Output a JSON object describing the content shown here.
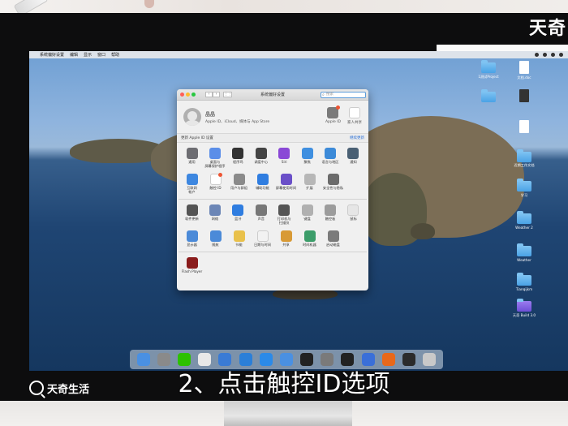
{
  "watermark_top": "天奇",
  "menubar": {
    "apple": "",
    "items": [
      "系统偏好设置",
      "编辑",
      "显示",
      "窗口",
      "帮助"
    ]
  },
  "window": {
    "title": "系统偏好设置",
    "search_placeholder": "搜索",
    "account": {
      "name": "晶晶",
      "subtitle": "Apple ID、iCloud、媒体与 App Store"
    },
    "top_buttons": [
      {
        "label": "Apple ID",
        "icon": "apple-id-icon"
      },
      {
        "label": "家人共享",
        "icon": "family-sharing-icon"
      }
    ],
    "notice": {
      "text": "更新 Apple ID 设置",
      "link": "继续更新"
    },
    "rows": [
      [
        {
          "label": "通用",
          "icon": "general-icon",
          "color": "#6d6d72"
        },
        {
          "label": "桌面与\n屏幕保护程序",
          "icon": "desktop-icon",
          "color": "#5b8ee8"
        },
        {
          "label": "程序坞",
          "icon": "dock-icon",
          "color": "#333333"
        },
        {
          "label": "调度中心",
          "icon": "mission-control-icon",
          "color": "#444444"
        },
        {
          "label": "Siri",
          "icon": "siri-icon",
          "color": "#8a48d6"
        },
        {
          "label": "聚焦",
          "icon": "spotlight-icon",
          "color": "#3f8fe0"
        },
        {
          "label": "语言与地区",
          "icon": "language-icon",
          "color": "#3c8ad8"
        },
        {
          "label": "通知",
          "icon": "notifications-icon",
          "color": "#4a6074"
        }
      ],
      [
        {
          "label": "互联网\n帐户",
          "icon": "internet-accounts-icon",
          "color": "#3d87e0"
        },
        {
          "label": "触控 ID",
          "icon": "touch-id-icon",
          "color": "#ffffff"
        },
        {
          "label": "用户与群组",
          "icon": "users-icon",
          "color": "#8a8a8a"
        },
        {
          "label": "辅助功能",
          "icon": "accessibility-icon",
          "color": "#2f7de0"
        },
        {
          "label": "屏幕使用时间",
          "icon": "screen-time-icon",
          "color": "#6a4fc8"
        },
        {
          "label": "扩展",
          "icon": "extensions-icon",
          "color": "#b7b7b7"
        },
        {
          "label": "安全性与隐私",
          "icon": "security-icon",
          "color": "#6b6b6b"
        }
      ],
      [
        {
          "label": "软件更新",
          "icon": "software-update-icon",
          "color": "#555555"
        },
        {
          "label": "网络",
          "icon": "network-icon",
          "color": "#6c86b6"
        },
        {
          "label": "蓝牙",
          "icon": "bluetooth-icon",
          "color": "#2f7de0"
        },
        {
          "label": "声音",
          "icon": "sound-icon",
          "color": "#777777"
        },
        {
          "label": "打印机与\n扫描仪",
          "icon": "printers-icon",
          "color": "#555555"
        },
        {
          "label": "键盘",
          "icon": "keyboard-icon",
          "color": "#b0b0b0"
        },
        {
          "label": "触控板",
          "icon": "trackpad-icon",
          "color": "#9c9c9c"
        },
        {
          "label": "鼠标",
          "icon": "mouse-icon",
          "color": "#e6e6e6"
        }
      ],
      [
        {
          "label": "显示器",
          "icon": "displays-icon",
          "color": "#4b8ad8"
        },
        {
          "label": "随航",
          "icon": "sidecar-icon",
          "color": "#4b8ad8"
        },
        {
          "label": "节能",
          "icon": "energy-saver-icon",
          "color": "#e9c14b"
        },
        {
          "label": "日期与时间",
          "icon": "date-time-icon",
          "color": "#f2f2f2"
        },
        {
          "label": "共享",
          "icon": "sharing-icon",
          "color": "#d89a35"
        },
        {
          "label": "时间机器",
          "icon": "time-machine-icon",
          "color": "#3c9d6a"
        },
        {
          "label": "启动磁盘",
          "icon": "startup-disk-icon",
          "color": "#7b7b7b"
        }
      ],
      [
        {
          "label": "Flash Player",
          "icon": "flash-player-icon",
          "color": "#8a1c1c"
        }
      ]
    ]
  },
  "desktop_icons": [
    {
      "label": "1测试Project",
      "kind": "folder"
    },
    {
      "label": "文档.doc",
      "kind": "doc"
    },
    {
      "label": "",
      "kind": "folder"
    },
    {
      "label": "",
      "kind": "image"
    },
    {
      "label": "",
      "kind": "doc"
    },
    {
      "label": "",
      "kind": "folder"
    },
    {
      "label": "近期工作文档",
      "kind": "folder"
    },
    {
      "label": "学习",
      "kind": "folder"
    },
    {
      "label": "",
      "kind": "folder"
    },
    {
      "label": "Weather 2",
      "kind": "folder"
    },
    {
      "label": "Weather",
      "kind": "folder"
    },
    {
      "label": "Tianqijkm",
      "kind": "folder"
    },
    {
      "label": "天奇 Build 3.0",
      "kind": "folder"
    }
  ],
  "dock_items": [
    {
      "icon": "finder-icon",
      "color": "#4a90e2"
    },
    {
      "icon": "launchpad-icon",
      "color": "#8a8a8a"
    },
    {
      "icon": "wechat-icon",
      "color": "#2dc100"
    },
    {
      "icon": "photos-icon",
      "color": "#e8e8e8"
    },
    {
      "icon": "xcode-icon",
      "color": "#3a7bd5"
    },
    {
      "icon": "files-icon",
      "color": "#2b7fd8"
    },
    {
      "icon": "app-store-icon",
      "color": "#2b8ae8"
    },
    {
      "icon": "upload-icon",
      "color": "#4a90e2"
    },
    {
      "icon": "terminal-icon",
      "color": "#222222"
    },
    {
      "icon": "system-preferences-icon",
      "color": "#7a7a7a"
    },
    {
      "icon": "qq-icon",
      "color": "#222222"
    },
    {
      "icon": "wps-icon",
      "color": "#3a6fd8"
    },
    {
      "icon": "firefox-icon",
      "color": "#e8681a"
    },
    {
      "icon": "activity-monitor-icon",
      "color": "#2b2b2b"
    },
    {
      "icon": "trash-icon",
      "color": "#c9c9c9"
    }
  ],
  "subtitle": "2、点击触控ID选项",
  "watermark_bottom": "天奇生活"
}
